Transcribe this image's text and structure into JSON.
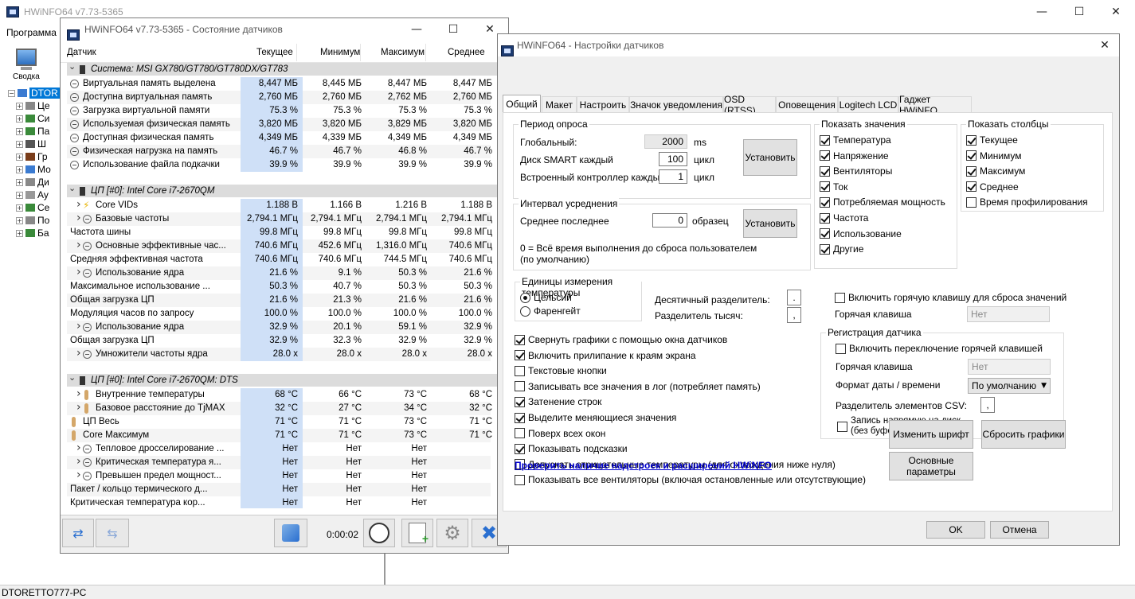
{
  "main_window": {
    "title": "HWiNFO64 v7.73-5365",
    "menu": "Программа",
    "toolbar_summary": "Сводка",
    "tree_root": "DTOR",
    "status": "DTORETTO777-PC",
    "tree_items": [
      "Це",
      "Си",
      "Па",
      "Ш",
      "Гр",
      "Мо",
      "Ди",
      "Ау",
      "Се",
      "По",
      "Ба"
    ]
  },
  "sensor_window": {
    "title": "HWiNFO64 v7.73-5365 - Состояние датчиков",
    "headers": {
      "name": "Датчик",
      "cur": "Текущее",
      "min": "Минимум",
      "max": "Максимум",
      "avg": "Среднее"
    },
    "groups": [
      {
        "title": "Система: MSI GX780/GT780/GT780DX/GT783",
        "rows": [
          {
            "n": "Виртуальная память выделена",
            "v": [
              "8,447 МБ",
              "8,445 МБ",
              "8,447 МБ",
              "8,447 МБ"
            ]
          },
          {
            "n": "Доступна виртуальная память",
            "v": [
              "2,760 МБ",
              "2,760 МБ",
              "2,762 МБ",
              "2,760 МБ"
            ]
          },
          {
            "n": "Загрузка виртуальной памяти",
            "v": [
              "75.3 %",
              "75.3 %",
              "75.3 %",
              "75.3 %"
            ]
          },
          {
            "n": "Используемая физическая память",
            "v": [
              "3,820 МБ",
              "3,820 МБ",
              "3,829 МБ",
              "3,820 МБ"
            ]
          },
          {
            "n": "Доступная физическая память",
            "v": [
              "4,349 МБ",
              "4,339 МБ",
              "4,349 МБ",
              "4,349 МБ"
            ]
          },
          {
            "n": "Физическая нагрузка на память",
            "v": [
              "46.7 %",
              "46.7 %",
              "46.8 %",
              "46.7 %"
            ]
          },
          {
            "n": "Использование файла подкачки",
            "v": [
              "39.9 %",
              "39.9 %",
              "39.9 %",
              "39.9 %"
            ]
          }
        ]
      },
      {
        "title": "ЦП [#0]: Intel Core i7-2670QM",
        "rows": [
          {
            "n": "Core VIDs",
            "v": [
              "1.188 В",
              "1.166 В",
              "1.216 В",
              "1.188 В"
            ]
          },
          {
            "n": "Базовые частоты",
            "v": [
              "2,794.1 МГц",
              "2,794.1 МГц",
              "2,794.1 МГц",
              "2,794.1 МГц"
            ]
          },
          {
            "n": "Частота шины",
            "v": [
              "99.8 МГц",
              "99.8 МГц",
              "99.8 МГц",
              "99.8 МГц"
            ]
          },
          {
            "n": "Основные эффективные час...",
            "v": [
              "740.6 МГц",
              "452.6 МГц",
              "1,316.0 МГц",
              "740.6 МГц"
            ]
          },
          {
            "n": "Средняя эффективная частота",
            "v": [
              "740.6 МГц",
              "740.6 МГц",
              "744.5 МГц",
              "740.6 МГц"
            ]
          },
          {
            "n": "Использование ядра",
            "v": [
              "21.6 %",
              "9.1 %",
              "50.3 %",
              "21.6 %"
            ]
          },
          {
            "n": "Максимальное использование ...",
            "v": [
              "50.3 %",
              "40.7 %",
              "50.3 %",
              "50.3 %"
            ]
          },
          {
            "n": "Общая загрузка ЦП",
            "v": [
              "21.6 %",
              "21.3 %",
              "21.6 %",
              "21.6 %"
            ]
          },
          {
            "n": "Модуляция часов по запросу",
            "v": [
              "100.0 %",
              "100.0 %",
              "100.0 %",
              "100.0 %"
            ]
          },
          {
            "n": "Использование ядра",
            "v": [
              "32.9 %",
              "20.1 %",
              "59.1 %",
              "32.9 %"
            ]
          },
          {
            "n": "Общая загрузка ЦП",
            "v": [
              "32.9 %",
              "32.3 %",
              "32.9 %",
              "32.9 %"
            ]
          },
          {
            "n": "Умножители частоты ядра",
            "v": [
              "28.0 x",
              "28.0 x",
              "28.0 x",
              "28.0 x"
            ]
          }
        ]
      },
      {
        "title": "ЦП [#0]: Intel Core i7-2670QM: DTS",
        "rows": [
          {
            "n": "Внутренние температуры",
            "v": [
              "68 °C",
              "66 °C",
              "73 °C",
              "68 °C"
            ]
          },
          {
            "n": "Базовое расстояние до TjMAX",
            "v": [
              "32 °C",
              "27 °C",
              "34 °C",
              "32 °C"
            ]
          },
          {
            "n": "ЦП Весь",
            "v": [
              "71 °C",
              "71 °C",
              "73 °C",
              "71 °C"
            ]
          },
          {
            "n": "Core Максимум",
            "v": [
              "71 °C",
              "71 °C",
              "73 °C",
              "71 °C"
            ]
          },
          {
            "n": "Тепловое дросселирование ...",
            "v": [
              "Нет",
              "Нет",
              "Нет",
              ""
            ]
          },
          {
            "n": "Критическая температура я...",
            "v": [
              "Нет",
              "Нет",
              "Нет",
              ""
            ]
          },
          {
            "n": "Превышен предел мощност...",
            "v": [
              "Нет",
              "Нет",
              "Нет",
              ""
            ]
          },
          {
            "n": "Пакет / кольцо термического д...",
            "v": [
              "Нет",
              "Нет",
              "Нет",
              ""
            ]
          },
          {
            "n": "Критическая температура кор...",
            "v": [
              "Нет",
              "Нет",
              "Нет",
              ""
            ]
          }
        ]
      }
    ],
    "timer": "0:00:02"
  },
  "settings_window": {
    "title": "HWiNFO64 - Настройки датчиков",
    "tabs": [
      "Общий",
      "Макет",
      "Настроить",
      "Значок уведомления",
      "OSD (RTSS)",
      "Оповещения",
      "Logitech LCD",
      "Гаджет HWiNFO"
    ],
    "polling": {
      "title": "Период опроса",
      "global_label": "Глобальный:",
      "global_value": "2000",
      "global_unit": "ms",
      "smart_label": "Диск SMART каждый",
      "smart_value": "100",
      "smart_unit": "цикл",
      "ec_label": "Встроенный контроллер каждый",
      "ec_value": "1",
      "ec_unit": "цикл",
      "set_button": "Установить"
    },
    "averaging": {
      "title": "Интервал усреднения",
      "label": "Среднее последнее",
      "value": "0",
      "unit": "образец",
      "set_button": "Установить",
      "note": "0 = Всё время выполнения до сброса пользователем (по умолчанию)"
    },
    "show_values": {
      "title": "Показать значения",
      "items": [
        {
          "label": "Температура",
          "checked": true
        },
        {
          "label": "Напряжение",
          "checked": true
        },
        {
          "label": "Вентиляторы",
          "checked": true
        },
        {
          "label": "Ток",
          "checked": true
        },
        {
          "label": "Потребляемая мощность",
          "checked": true
        },
        {
          "label": "Частота",
          "checked": true
        },
        {
          "label": "Использование",
          "checked": true
        },
        {
          "label": "Другие",
          "checked": true
        }
      ]
    },
    "show_columns": {
      "title": "Показать столбцы",
      "items": [
        {
          "label": "Текущее",
          "checked": true
        },
        {
          "label": "Минимум",
          "checked": true
        },
        {
          "label": "Максимум",
          "checked": true
        },
        {
          "label": "Среднее",
          "checked": true
        },
        {
          "label": "Время профилирования",
          "checked": false
        }
      ]
    },
    "temp_units": {
      "title": "Единицы измерения температуры",
      "celsius": "Цельсий",
      "fahrenheit": "Фаренгейт",
      "decimal_label": "Десятичный разделитель:",
      "decimal_value": ".",
      "thousands_label": "Разделитель тысяч:",
      "thousands_value": ","
    },
    "hotkey_reset": {
      "label": "Включить горячую клавишу для сброса значений",
      "hotkey_label": "Горячая клавиша",
      "hotkey_value": "Нет"
    },
    "options": [
      {
        "label": "Свернуть графики с помощью окна датчиков",
        "checked": true
      },
      {
        "label": "Включить прилипание к краям экрана",
        "checked": true
      },
      {
        "label": "Текстовые кнопки",
        "checked": false
      },
      {
        "label": "Записывать все значения в лог (потребляет память)",
        "checked": false
      },
      {
        "label": "Затенение строк",
        "checked": true
      },
      {
        "label": "Выделите меняющиеся значения",
        "checked": true
      },
      {
        "label": "Поверх всех окон",
        "checked": false
      },
      {
        "label": "Показывать подсказки",
        "checked": true
      },
      {
        "label": "Допускать отрицательные температуры (для охлаждения ниже нуля)",
        "checked": false
      },
      {
        "label": "Показывать все вентиляторы (включая остановленные или отсутствующие)",
        "checked": false
      }
    ],
    "logging": {
      "title": "Регистрация датчика",
      "toggle_label": "Включить переключение горячей клавишей",
      "hotkey_label": "Горячая клавиша",
      "hotkey_value": "Нет",
      "date_label": "Формат даты / времени",
      "date_value": "По умолчанию",
      "csv_label": "Разделитель элементов CSV:",
      "csv_value": ",",
      "direct_label_1": "Запись напрямую на диск",
      "direct_label_2": "(без буферизации)"
    },
    "link": "Проверить наличие надстроек и расширений HWiNFO",
    "buttons": {
      "font": "Изменить шрифт",
      "reset_graphs": "Сбросить графики",
      "basic_1": "Основные",
      "basic_2": "параметры",
      "ok": "OK",
      "cancel": "Отмена"
    }
  },
  "colors": {
    "highlight": "#cfe0f7",
    "link": "#0000cc",
    "group_bg": "#dcdcdc"
  }
}
